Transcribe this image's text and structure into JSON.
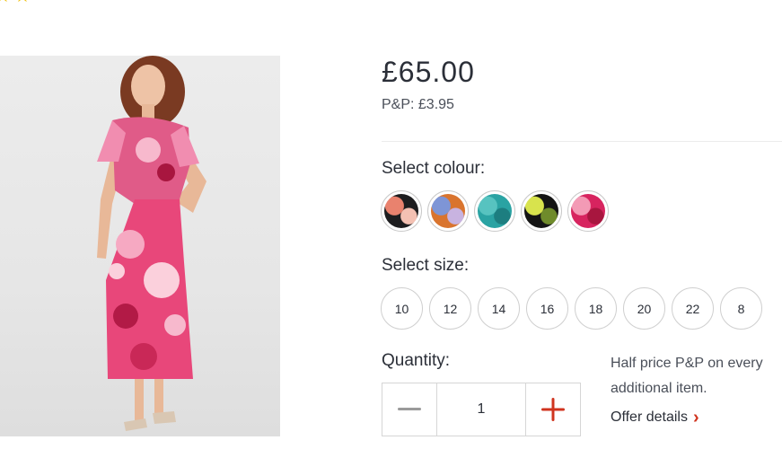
{
  "rating": {
    "stars": [
      "★",
      "★"
    ]
  },
  "product": {
    "price": "£65.00",
    "postage": "P&P: £3.95"
  },
  "colour": {
    "label": "Select colour:",
    "swatches": [
      {
        "name": "black-floral",
        "colors": [
          "#1d1d1f",
          "#e9826e",
          "#f4c1b3"
        ]
      },
      {
        "name": "orange-blue",
        "colors": [
          "#d9742e",
          "#7e95d6",
          "#c8b3e0"
        ]
      },
      {
        "name": "teal",
        "colors": [
          "#2aa3a3",
          "#57c3c0",
          "#1d7e80"
        ]
      },
      {
        "name": "black-yellow",
        "colors": [
          "#141414",
          "#d8e34d",
          "#6f8b2b"
        ]
      },
      {
        "name": "pink",
        "colors": [
          "#d7245f",
          "#f39ab5",
          "#a8163f"
        ]
      }
    ]
  },
  "size": {
    "label": "Select size:",
    "options": [
      "10",
      "12",
      "14",
      "16",
      "18",
      "20",
      "22",
      "8"
    ]
  },
  "quantity": {
    "label": "Quantity:",
    "value": "1",
    "minus_color": "#9a9a9a",
    "plus_color": "#d0341f"
  },
  "offer": {
    "line1": "Half price P&P on every",
    "line2": "additional item.",
    "link": "Offer details",
    "link_chevron": "›"
  }
}
